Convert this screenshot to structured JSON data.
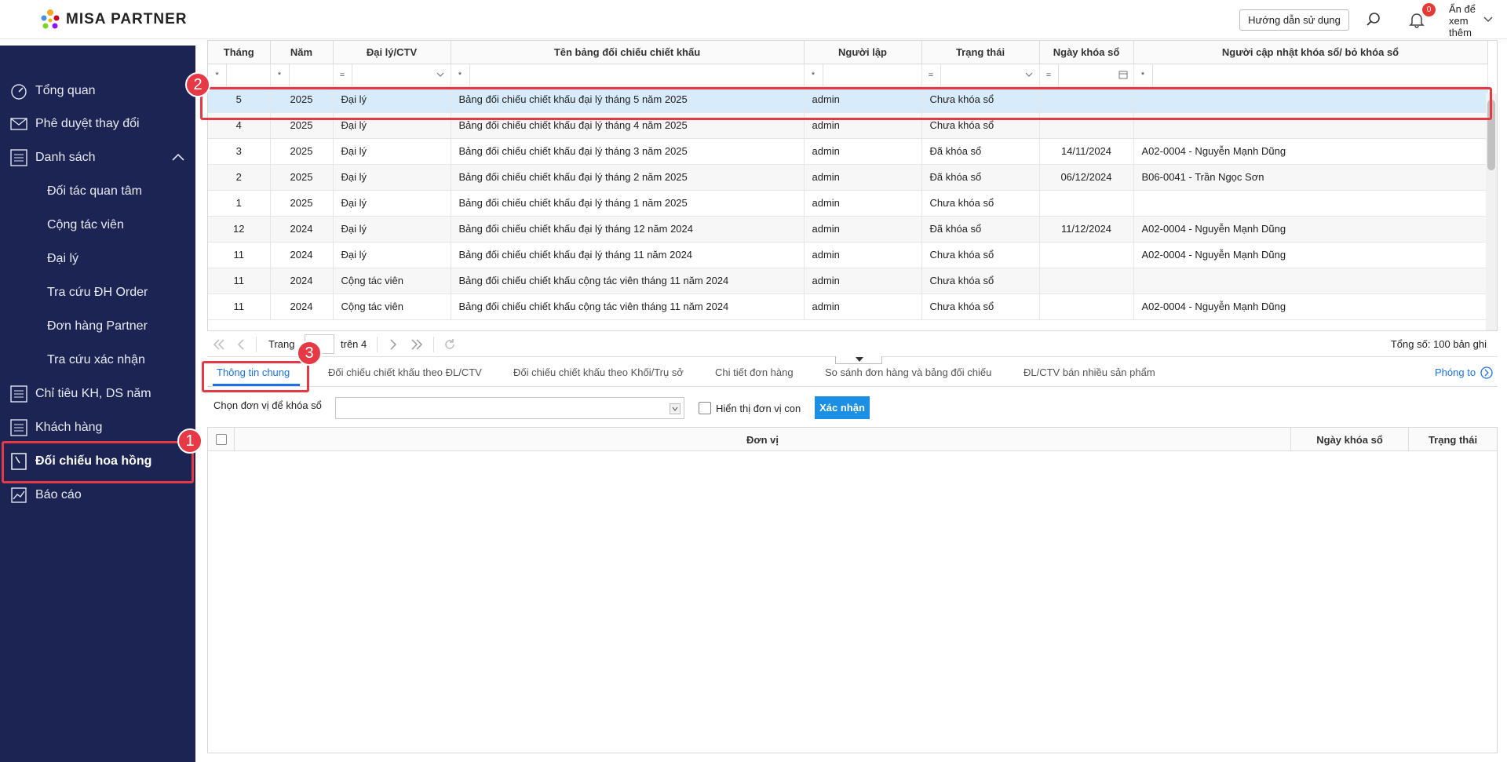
{
  "app": {
    "brand": "MISA PARTNER"
  },
  "topbar": {
    "guide_label": "Hướng dẫn sử dụng",
    "notification_count": "0",
    "hide_label": "Ẩn để xem thêm"
  },
  "sidebar": {
    "items": [
      {
        "label": "Tổng quan"
      },
      {
        "label": "Phê duyệt thay đổi"
      },
      {
        "label": "Danh sách"
      },
      {
        "label": "Đối tác quan tâm"
      },
      {
        "label": "Cộng tác viên"
      },
      {
        "label": "Đại lý"
      },
      {
        "label": "Tra cứu ĐH Order"
      },
      {
        "label": "Đơn hàng Partner"
      },
      {
        "label": "Tra cứu xác nhận"
      },
      {
        "label": "Chỉ tiêu KH, DS năm"
      },
      {
        "label": "Khách hàng"
      },
      {
        "label": "Đối chiếu hoa hồng"
      },
      {
        "label": "Báo cáo"
      }
    ]
  },
  "callouts": [
    "1",
    "2",
    "3"
  ],
  "grid": {
    "columns": [
      "Tháng",
      "Năm",
      "Đại lý/CTV",
      "Tên bảng đối chiếu chiết khấu",
      "Người lập",
      "Trạng thái",
      "Ngày khóa sổ",
      "Người cập nhật khóa sổ/ bỏ khóa sổ"
    ],
    "filter_ops": [
      "*",
      "*",
      "=",
      "*",
      "*",
      "=",
      "=",
      "*"
    ],
    "rows": [
      [
        "5",
        "2025",
        "Đại lý",
        "Bảng đối chiếu chiết khấu đại lý tháng 5 năm 2025",
        "admin",
        "Chưa khóa sổ",
        "",
        ""
      ],
      [
        "4",
        "2025",
        "Đại lý",
        "Bảng đối chiếu chiết khấu đại lý tháng 4 năm 2025",
        "admin",
        "Chưa khóa sổ",
        "",
        ""
      ],
      [
        "3",
        "2025",
        "Đại lý",
        "Bảng đối chiếu chiết khấu đại lý tháng 3 năm 2025",
        "admin",
        "Đã khóa sổ",
        "14/11/2024",
        "A02-0004 - Nguyễn Mạnh Dũng"
      ],
      [
        "2",
        "2025",
        "Đại lý",
        "Bảng đối chiếu chiết khấu đại lý tháng 2 năm 2025",
        "admin",
        "Đã khóa sổ",
        "06/12/2024",
        "B06-0041 - Trần Ngọc Sơn"
      ],
      [
        "1",
        "2025",
        "Đại lý",
        "Bảng đối chiếu chiết khấu đại lý tháng 1 năm 2025",
        "admin",
        "Chưa khóa sổ",
        "",
        ""
      ],
      [
        "12",
        "2024",
        "Đại lý",
        "Bảng đối chiếu chiết khấu đại lý tháng 12 năm 2024",
        "admin",
        "Đã khóa sổ",
        "11/12/2024",
        "A02-0004 - Nguyễn Mạnh Dũng"
      ],
      [
        "11",
        "2024",
        "Đại lý",
        "Bảng đối chiếu chiết khấu đại lý tháng 11 năm 2024",
        "admin",
        "Chưa khóa sổ",
        "",
        "A02-0004 - Nguyễn Mạnh Dũng"
      ],
      [
        "11",
        "2024",
        "Cộng tác viên",
        "Bảng đối chiếu chiết khấu cộng tác viên tháng 11 năm 2024",
        "admin",
        "Chưa khóa sổ",
        "",
        ""
      ],
      [
        "11",
        "2024",
        "Cộng tác viên",
        "Bảng đối chiếu chiết khấu cộng tác viên tháng 11 năm 2024",
        "admin",
        "Chưa khóa sổ",
        "",
        "A02-0004 - Nguyễn Mạnh Dũng"
      ]
    ]
  },
  "pager": {
    "page_label": "Trang",
    "of_label": "trên 4",
    "total_label": "Tổng số: 100 bản ghi"
  },
  "tabs": [
    {
      "label": "Thông tin chung"
    },
    {
      "label": "Đối chiếu chiết khấu theo ĐL/CTV"
    },
    {
      "label": "Đối chiếu chiết khấu theo Khối/Trụ sở"
    },
    {
      "label": "Chi tiết đơn hàng"
    },
    {
      "label": "So sánh đơn hàng và bảng đối chiếu"
    },
    {
      "label": "ĐL/CTV bán nhiều sản phẩm"
    }
  ],
  "zoom_label": "Phóng to",
  "lock_form": {
    "select_label": "Chọn đơn vị để khóa sổ",
    "show_child_label": "Hiển thị đơn vị con",
    "confirm_label": "Xác nhận"
  },
  "lower_grid": {
    "columns": [
      "Đơn vị",
      "Ngày khóa sổ",
      "Trạng thái"
    ]
  },
  "colors": {
    "sidebar_bg": "#1c2453",
    "accent": "#1a73e8",
    "highlight": "#e53945",
    "selected_row": "#d8ebfb"
  }
}
